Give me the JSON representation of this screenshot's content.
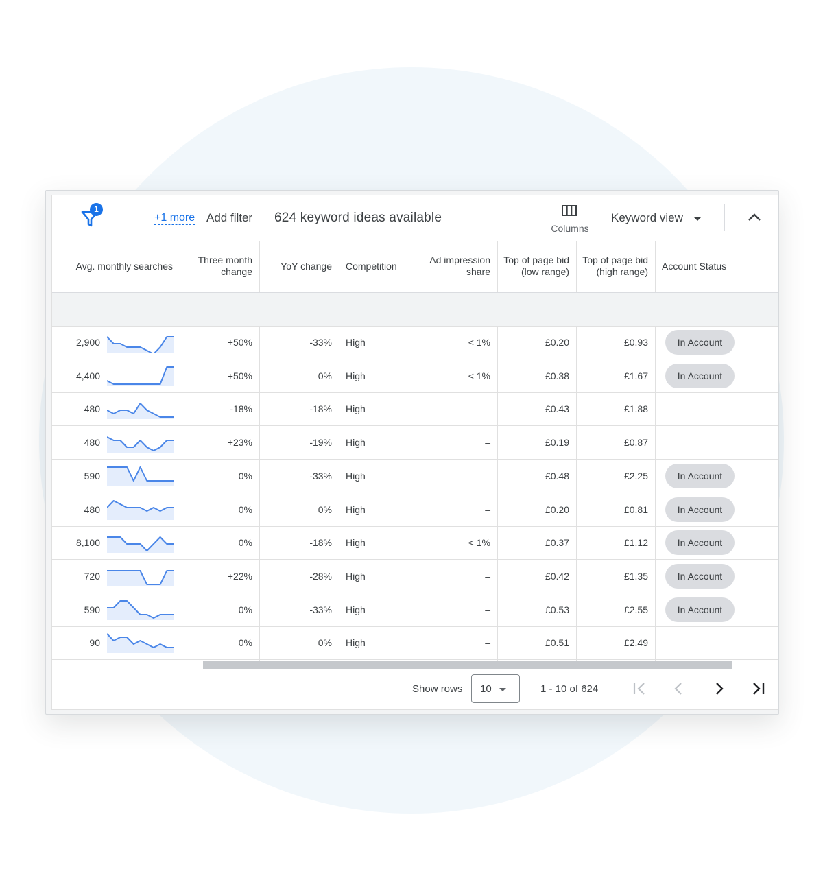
{
  "toolbar": {
    "filter_badge": "1",
    "more_filters": "+1 more",
    "add_filter": "Add filter",
    "ideas_count": "624 keyword ideas available",
    "columns_label": "Columns",
    "keyword_view": "Keyword view",
    "icons": [
      "filter-icon",
      "columns-icon",
      "dropdown-caret-icon",
      "collapse-chevron-icon"
    ]
  },
  "columns": [
    "Avg. monthly searches",
    "Three month change",
    "YoY change",
    "Competition",
    "Ad impression share",
    "Top of page bid (low range)",
    "Top of page bid (high range)",
    "Account Status"
  ],
  "rows": [
    {
      "searches": "2,900",
      "three_month": "+50%",
      "yoy": "-33%",
      "competition": "High",
      "impression": "< 1%",
      "bid_low": "£0.20",
      "bid_high": "£0.93",
      "status": "In Account",
      "trend": [
        4,
        2,
        2,
        1,
        1,
        1,
        0,
        -1,
        1,
        4,
        4
      ]
    },
    {
      "searches": "4,400",
      "three_month": "+50%",
      "yoy": "0%",
      "competition": "High",
      "impression": "< 1%",
      "bid_low": "£0.38",
      "bid_high": "£1.67",
      "status": "In Account",
      "trend": [
        1,
        0,
        0,
        0,
        0,
        0,
        0,
        0,
        0,
        5,
        5
      ]
    },
    {
      "searches": "480",
      "three_month": "-18%",
      "yoy": "-18%",
      "competition": "High",
      "impression": "–",
      "bid_low": "£0.43",
      "bid_high": "£1.88",
      "status": "",
      "trend": [
        2,
        1,
        2,
        2,
        1,
        4,
        2,
        1,
        0,
        0,
        0
      ]
    },
    {
      "searches": "480",
      "three_month": "+23%",
      "yoy": "-19%",
      "competition": "High",
      "impression": "–",
      "bid_low": "£0.19",
      "bid_high": "£0.87",
      "status": "",
      "trend": [
        4,
        3,
        3,
        1,
        1,
        3,
        1,
        0,
        1,
        3,
        3
      ]
    },
    {
      "searches": "590",
      "three_month": "0%",
      "yoy": "-33%",
      "competition": "High",
      "impression": "–",
      "bid_low": "£0.48",
      "bid_high": "£2.25",
      "status": "In Account",
      "trend": [
        5,
        5,
        5,
        5,
        1,
        5,
        1,
        1,
        1,
        1,
        1
      ]
    },
    {
      "searches": "480",
      "three_month": "0%",
      "yoy": "0%",
      "competition": "High",
      "impression": "–",
      "bid_low": "£0.20",
      "bid_high": "£0.81",
      "status": "In Account",
      "trend": [
        3,
        5,
        4,
        3,
        3,
        3,
        2,
        3,
        2,
        3,
        3
      ]
    },
    {
      "searches": "8,100",
      "three_month": "0%",
      "yoy": "-18%",
      "competition": "High",
      "impression": "< 1%",
      "bid_low": "£0.37",
      "bid_high": "£1.12",
      "status": "In Account",
      "trend": [
        4,
        4,
        4,
        2,
        2,
        2,
        0,
        2,
        4,
        2,
        2
      ]
    },
    {
      "searches": "720",
      "three_month": "+22%",
      "yoy": "-28%",
      "competition": "High",
      "impression": "–",
      "bid_low": "£0.42",
      "bid_high": "£1.35",
      "status": "In Account",
      "trend": [
        4,
        4,
        4,
        4,
        4,
        4,
        0,
        0,
        0,
        4,
        4
      ]
    },
    {
      "searches": "590",
      "three_month": "0%",
      "yoy": "-33%",
      "competition": "High",
      "impression": "–",
      "bid_low": "£0.53",
      "bid_high": "£2.55",
      "status": "In Account",
      "trend": [
        3,
        3,
        5,
        5,
        3,
        1,
        1,
        0,
        1,
        1,
        1
      ]
    },
    {
      "searches": "90",
      "three_month": "0%",
      "yoy": "0%",
      "competition": "High",
      "impression": "–",
      "bid_low": "£0.51",
      "bid_high": "£2.49",
      "status": "",
      "trend": [
        5,
        3,
        4,
        4,
        2,
        3,
        2,
        1,
        2,
        1,
        1
      ]
    }
  ],
  "footer": {
    "show_rows_label": "Show rows",
    "rows_per_page": "10",
    "range": "1 - 10 of 624",
    "icons": [
      "first-page-icon",
      "previous-page-icon",
      "next-page-icon",
      "last-page-icon"
    ]
  },
  "colors": {
    "accent": "#1a73e8",
    "sparkline": "#4a86e8",
    "sparkline_fill": "#e4edfc",
    "pill": "#dadce0",
    "summary_row": "#f1f3f4"
  }
}
